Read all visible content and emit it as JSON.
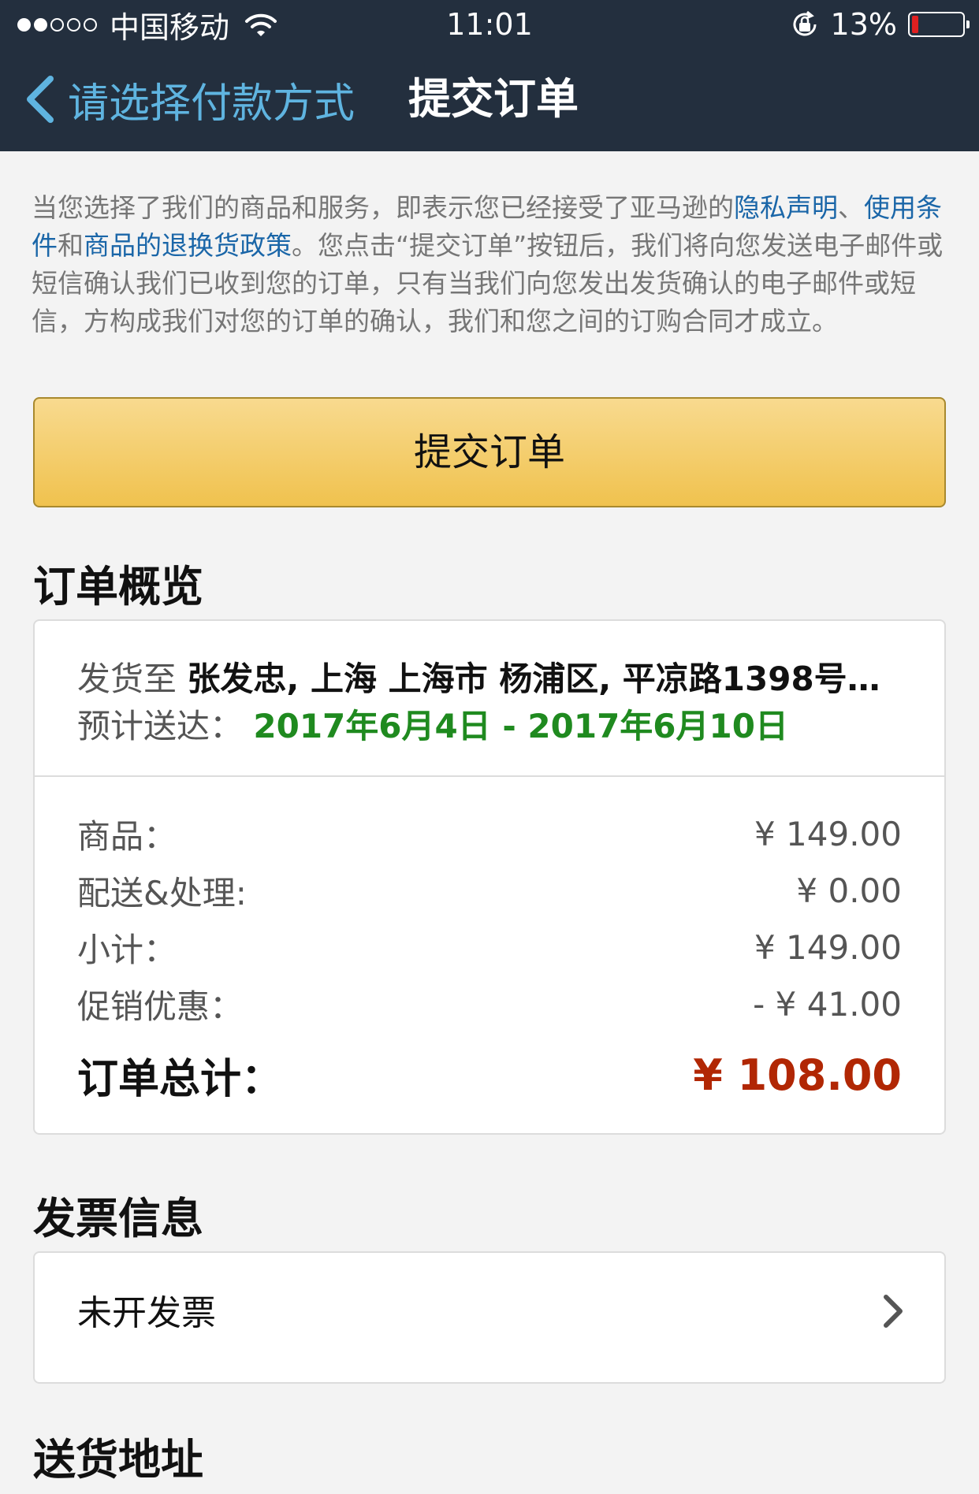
{
  "status_bar": {
    "carrier": "中国移动",
    "time": "11:01",
    "battery": "13%",
    "battery_level": 0.13,
    "signal_dots_filled": 2,
    "signal_dots_total": 5
  },
  "nav": {
    "back_label": "请选择付款方式",
    "title": "提交订单"
  },
  "legal": {
    "part1": "当您选择了我们的商品和服务，即表示您已经接受了亚马逊的",
    "privacy_link": "隐私声明",
    "sep": "、",
    "terms_link": "使用条件",
    "and": "和",
    "returns_link": "商品的退换货政策",
    "part2": "。您点击“提交订单”按钮后，我们将向您发送电子邮件或短信确认我们已收到您的订单，只有当我们向您发出发货确认的电子邮件或短信，方构成我们对您的订单的确认，我们和您之间的订购合同才成立。"
  },
  "submit_button": "提交订单",
  "overview": {
    "title": "订单概览",
    "ship_to_label": "发货至",
    "ship_to_value": "张发忠, 上海 上海市 杨浦区, 平凉路1398号…",
    "eta_label": "预计送达：",
    "eta_value": "2017年6月4日 - 2017年6月10日",
    "rows": [
      {
        "label": "商品：",
        "value": "¥ 149.00"
      },
      {
        "label": "配送&处理:",
        "value": "¥ 0.00"
      },
      {
        "label": "小计：",
        "value": "¥ 149.00"
      },
      {
        "label": "促销优惠：",
        "value": "- ¥ 41.00"
      }
    ],
    "total_label": "订单总计：",
    "total_value": "¥ 108.00"
  },
  "invoice": {
    "title": "发票信息",
    "value": "未开发票"
  },
  "address": {
    "title": "送货地址"
  },
  "colors": {
    "header_bg": "#232f3e",
    "link": "#1a66a8",
    "button": "#f0c24e",
    "eta": "#1f8a1f",
    "total": "#b12704"
  }
}
